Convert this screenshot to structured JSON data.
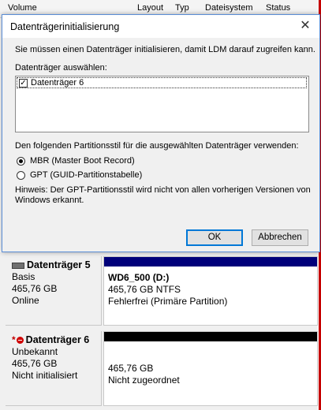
{
  "background": {
    "columns": [
      "Volume",
      "Layout",
      "Typ",
      "Dateisystem",
      "Status"
    ],
    "disks": [
      {
        "name": "Datenträger 5",
        "type": "Basis",
        "size": "465,76 GB",
        "state": "Online",
        "partition": {
          "name": "WD6_500  (D:)",
          "size": "465,76 GB NTFS",
          "status": "Fehlerfrei (Primäre Partition)"
        }
      },
      {
        "name": "Datenträger 6",
        "prefix": "*",
        "type": "Unbekannt",
        "size": "465,76 GB",
        "state": "Nicht initialisiert",
        "partition": {
          "size": "465,76 GB",
          "status": "Nicht zugeordnet"
        }
      }
    ]
  },
  "dialog": {
    "title": "Datenträgerinitialisierung",
    "close_glyph": "✕",
    "intro": "Sie müssen einen Datenträger initialisieren, damit LDM darauf zugreifen kann.",
    "select_label": "Datenträger auswählen:",
    "disk_items": [
      {
        "label": "Datenträger 6",
        "checked": true,
        "check_glyph": "✓"
      }
    ],
    "style_label": "Den folgenden Partitionsstil für die ausgewählten Datenträger verwenden:",
    "options": [
      {
        "label": "MBR (Master Boot Record)",
        "selected": true
      },
      {
        "label": "GPT (GUID-Partitionstabelle)",
        "selected": false
      }
    ],
    "hint_line1": "Hinweis: Der GPT-Partitionsstil wird nicht von allen vorherigen Versionen von",
    "hint_line2": "Windows erkannt.",
    "ok_label": "OK",
    "cancel_label": "Abbrechen"
  },
  "colors": {
    "accent": "#0078d7",
    "disk_bar": "#00007a",
    "unallocated_bar": "#000000",
    "window_edge": "#c50000"
  }
}
